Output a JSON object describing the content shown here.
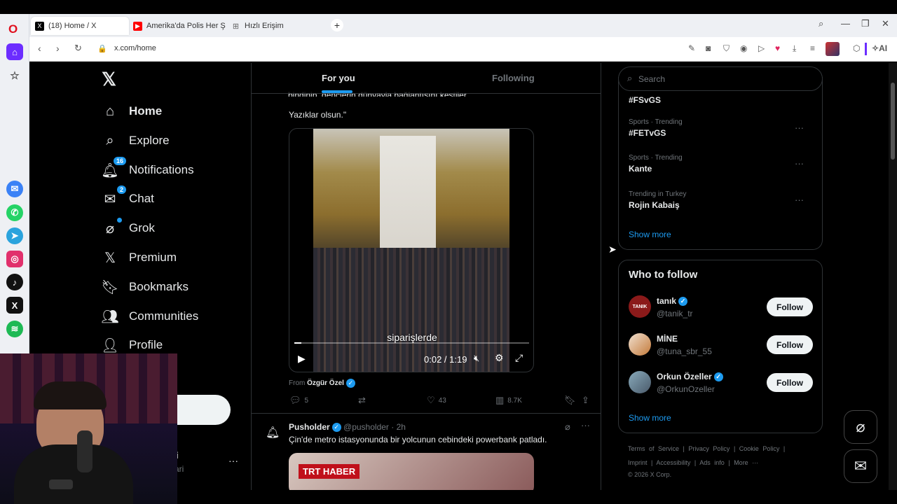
{
  "browser": {
    "tabs": [
      {
        "label": "(18) Home / X",
        "icon": "x-logo-icon"
      },
      {
        "label": "Amerika'da Polis Her Şeyi",
        "icon": "youtube-icon"
      },
      {
        "label": "Hızlı Erişim",
        "icon": "grid-icon"
      }
    ],
    "new_tab": "+",
    "url": "x.com/home",
    "ai_label": "AI"
  },
  "nav": {
    "items": [
      {
        "label": "Home",
        "icon": "home-icon"
      },
      {
        "label": "Explore",
        "icon": "search-icon"
      },
      {
        "label": "Notifications",
        "icon": "bell-icon",
        "badge": "16"
      },
      {
        "label": "Chat",
        "icon": "mail-icon",
        "badge": "2"
      },
      {
        "label": "Grok",
        "icon": "grok-icon"
      },
      {
        "label": "Premium",
        "icon": "x-logo-icon"
      },
      {
        "label": "Bookmarks",
        "icon": "bookmark-icon"
      },
      {
        "label": "Communities",
        "icon": "people-icon"
      },
      {
        "label": "Profile",
        "icon": "person-icon"
      }
    ],
    "account_name_fragment": "i",
    "account_handle_fragment": "ari"
  },
  "feed": {
    "tabs": {
      "for_you": "For you",
      "following": "Following"
    },
    "post1": {
      "text_partial": "bindinip, gençlerin dünyayla bağlantısını kestiler.",
      "text_end": "Yazıklar olsun.\"",
      "video": {
        "subtitle": "siparişlerde",
        "time": "0:02 / 1:19",
        "progress": 0.03
      },
      "from_label": "From",
      "from_name": "Özgür Özel",
      "replies": "5",
      "likes": "43",
      "views": "8.7K"
    },
    "post2": {
      "name": "Pusholder",
      "handle": "@pusholder",
      "time": "· 2h",
      "text": "Çin'de metro istasyonunda bir yolcunun cebindeki powerbank patladı.",
      "image_label": "TRT HABER"
    }
  },
  "sidebar": {
    "search_placeholder": "Search",
    "trends": [
      {
        "meta": "",
        "tag": "#FSvGS"
      },
      {
        "meta": "Sports · Trending",
        "tag": "#FETvGS"
      },
      {
        "meta": "Sports · Trending",
        "tag": "Kante"
      },
      {
        "meta": "Trending in Turkey",
        "tag": "Rojin Kabaiş"
      }
    ],
    "show_more": "Show more",
    "who_to_follow": {
      "title": "Who to follow",
      "users": [
        {
          "name": "tanık",
          "handle": "@tanik_tr",
          "verified": true,
          "avatar_text": "TANIK",
          "avatar_color": "#8b1a1a"
        },
        {
          "name": "MİNE",
          "handle": "@tuna_sbr_55",
          "verified": false,
          "avatar_text": "",
          "avatar_color": "#c47a3a"
        },
        {
          "name": "Orkun Özeller",
          "handle": "@OrkunOzeller",
          "verified": true,
          "avatar_text": "",
          "avatar_color": "#4a5a6a"
        }
      ],
      "follow_label": "Follow",
      "show_more": "Show more"
    },
    "footer": {
      "row1": [
        "Terms of Service",
        "|",
        "Privacy Policy",
        "|",
        "Cookie Policy",
        "|"
      ],
      "row2": [
        "Imprint",
        "|",
        "Accessibility",
        "|",
        "Ads info",
        "|",
        "More ···"
      ],
      "copyright": "© 2026 X Corp."
    }
  },
  "colors": {
    "accent": "#1d9bf0",
    "background": "#000000",
    "border": "#2f3336"
  }
}
